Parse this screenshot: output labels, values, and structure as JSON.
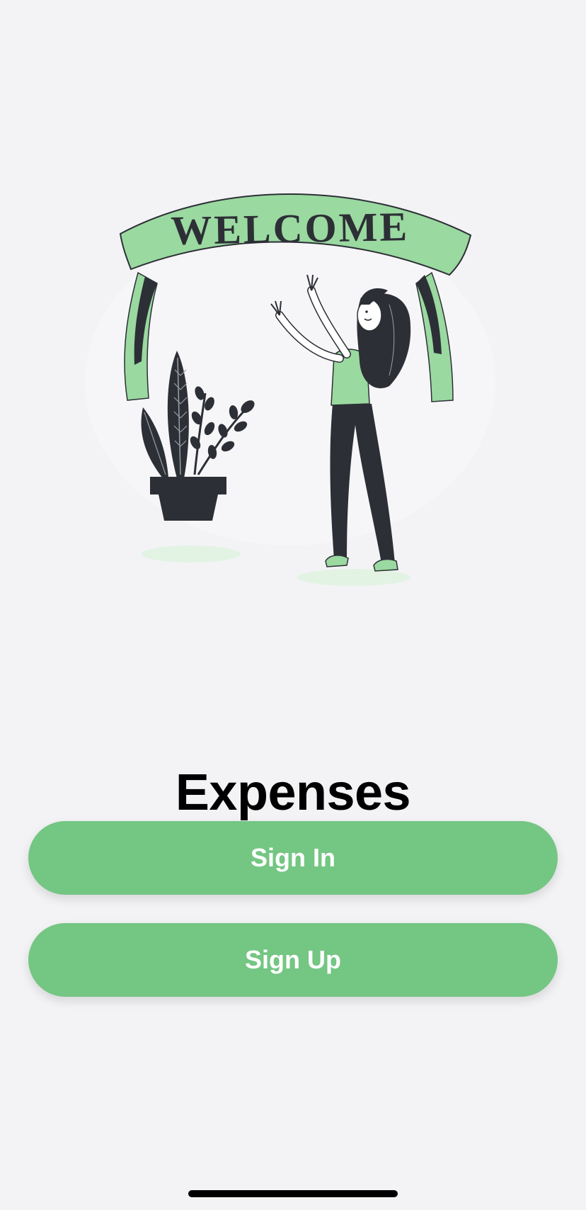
{
  "illustration": {
    "banner_text": "WELCOME",
    "accent_color": "#9ad9a0",
    "dark_color": "#2d2f36"
  },
  "app": {
    "title": "Expenses"
  },
  "buttons": {
    "sign_in": "Sign In",
    "sign_up": "Sign Up",
    "color": "#74c683"
  }
}
